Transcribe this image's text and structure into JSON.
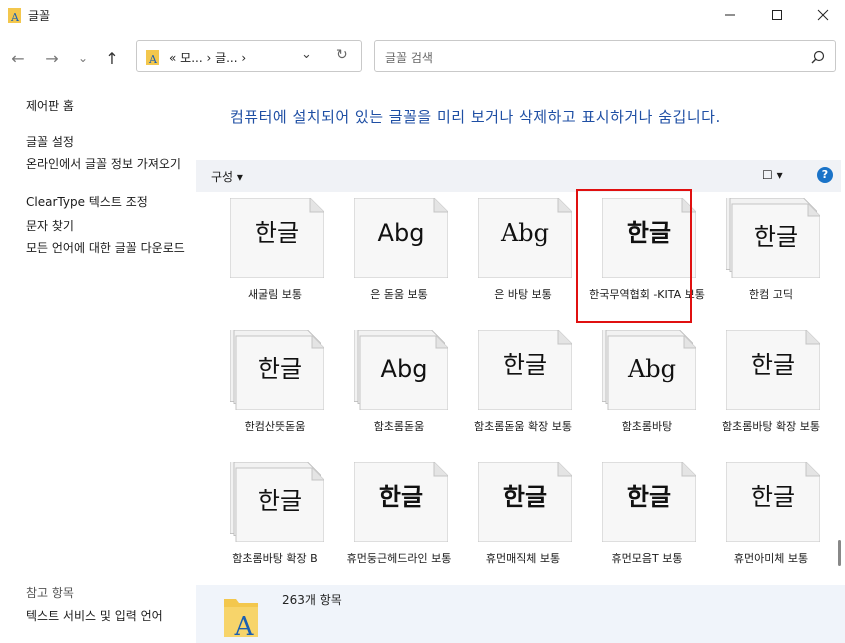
{
  "window": {
    "title": "글꼴"
  },
  "nav": {
    "back": "←",
    "forward": "→",
    "recent": "⌄",
    "up": "↑"
  },
  "address": {
    "crumbs": "« 모...  ›  글...  ›",
    "dropdown": "⌄",
    "refresh": "↻"
  },
  "search": {
    "placeholder": "글꼴 검색"
  },
  "sidebar": {
    "home": "제어판 홈",
    "links": [
      "글꼴 설정",
      "온라인에서 글꼴 정보 가져오기",
      "ClearType 텍스트 조정",
      "문자 찾기",
      "모든 언어에 대한 글꼴 다운로드"
    ],
    "see_also_title": "참고 항목",
    "see_also": [
      "텍스트 서비스 및 입력 언어"
    ]
  },
  "main": {
    "heading": "컴퓨터에 설치되어 있는 글꼴을 미리 보거나 삭제하고 표시하거나 숨깁니다."
  },
  "toolbar": {
    "organize": "구성 ▾",
    "view": "☐ ▾",
    "help": "?"
  },
  "fonts": [
    {
      "name": "새굴림 보통",
      "sample": "한글",
      "stack": false
    },
    {
      "name": "은 돋움 보통",
      "sample": "Abg",
      "stack": false
    },
    {
      "name": "은 바탕 보통",
      "sample": "Abg",
      "stack": false
    },
    {
      "name": "한국무역협회 -KITA 보통",
      "sample": "한글",
      "stack": false
    },
    {
      "name": "한컴 고딕",
      "sample": "한글",
      "stack": true
    },
    {
      "name": "한컴산뜻돋움",
      "sample": "한글",
      "stack": true
    },
    {
      "name": "함초롬돋움",
      "sample": "Abg",
      "stack": true
    },
    {
      "name": "함초롬돋움 확장 보통",
      "sample": "한글",
      "stack": false
    },
    {
      "name": "함초롬바탕",
      "sample": "Abg",
      "stack": true
    },
    {
      "name": "함초롬바탕 확장 보통",
      "sample": "한글",
      "stack": false
    },
    {
      "name": "함초롬바탕 확장 B",
      "sample": "한글",
      "stack": true
    },
    {
      "name": "휴먼둥근헤드라인 보통",
      "sample": "한글",
      "stack": false
    },
    {
      "name": "휴먼매직체 보통",
      "sample": "한글",
      "stack": false
    },
    {
      "name": "휴먼모음T 보통",
      "sample": "한글",
      "stack": false
    },
    {
      "name": "휴먼아미체 보통",
      "sample": "한글",
      "stack": false
    }
  ],
  "details": {
    "count": "263개 항목"
  }
}
